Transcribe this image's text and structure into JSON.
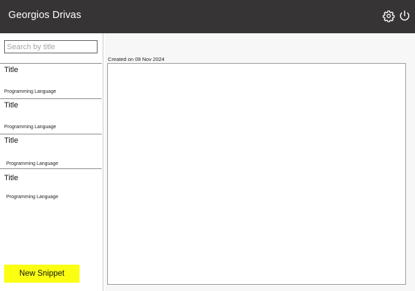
{
  "header": {
    "user_name": "Georgios Drivas",
    "background_color": "#363435",
    "icons": [
      "gear-icon",
      "power-icon"
    ]
  },
  "sidebar": {
    "search": {
      "placeholder": "Search by title",
      "value": ""
    },
    "snippets": [
      {
        "title": "Title",
        "language": "Programming Language"
      },
      {
        "title": "Title",
        "language": "Programming Language"
      },
      {
        "title": "Title",
        "language": "Programming Language"
      },
      {
        "title": "Title",
        "language": "Programming Language"
      }
    ],
    "new_snippet_label": "New Snippet",
    "new_snippet_color": "#fbff12"
  },
  "main": {
    "created_label": "Created on 09 Nov 2024",
    "editor_content": ""
  }
}
